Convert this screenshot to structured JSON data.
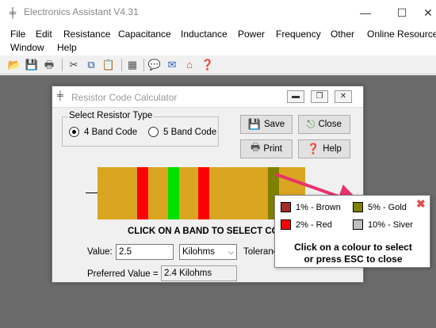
{
  "window": {
    "title": "Electronics Assistant V4.31",
    "controls": {
      "minimize": "—",
      "maximize": "☐",
      "close": "✕"
    }
  },
  "menu": {
    "items": [
      "File",
      "Edit",
      "Resistance",
      "Capacitance",
      "Inductance",
      "Power",
      "Frequency",
      "Other",
      "Online Resources",
      "Window",
      "Help"
    ]
  },
  "toolbar": {
    "icons": [
      "open-folder-icon",
      "save-icon",
      "print-icon",
      "cut-icon",
      "copy-icon",
      "paste-icon",
      "calculator-icon",
      "chat-icon",
      "mail-icon",
      "home-icon",
      "help-icon"
    ]
  },
  "dialog": {
    "title": "Resistor Code Calculator",
    "group_label": "Select Resistor Type",
    "radio_4band": "4 Band Code",
    "radio_5band": "5 Band Code",
    "selected_type": "4 Band Code",
    "btn_save": "Save",
    "btn_close": "Close",
    "btn_print": "Print",
    "btn_help": "Help",
    "instruction": "CLICK ON A BAND TO SELECT COLO",
    "value_label": "Value:",
    "value": "2.5",
    "unit": "Kilohms",
    "tolerance_label": "Toleranc",
    "preferred_label": "Preferred Value =",
    "preferred_value": "2.4 Kilohms",
    "resistor_body_color": "#daa520",
    "bands": [
      {
        "color": "#ff0000",
        "name": "red-band"
      },
      {
        "color": "#00e000",
        "name": "green-band"
      },
      {
        "color": "#ff0000",
        "name": "red-band"
      },
      {
        "color": "#808000",
        "name": "gold-tolerance-band"
      }
    ]
  },
  "popup": {
    "options": [
      {
        "label": "1% - Brown",
        "color": "#a52a2a"
      },
      {
        "label": "5% - Gold",
        "color": "#808000"
      },
      {
        "label": "2% - Red",
        "color": "#ff0000"
      },
      {
        "label": "10% - Siver",
        "color": "#c0c0c0"
      }
    ],
    "message_line1": "Click on a colour to select",
    "message_line2": "or press ESC to close",
    "close_icon": "✖"
  },
  "accent": {
    "arrow": "#e8336d"
  }
}
